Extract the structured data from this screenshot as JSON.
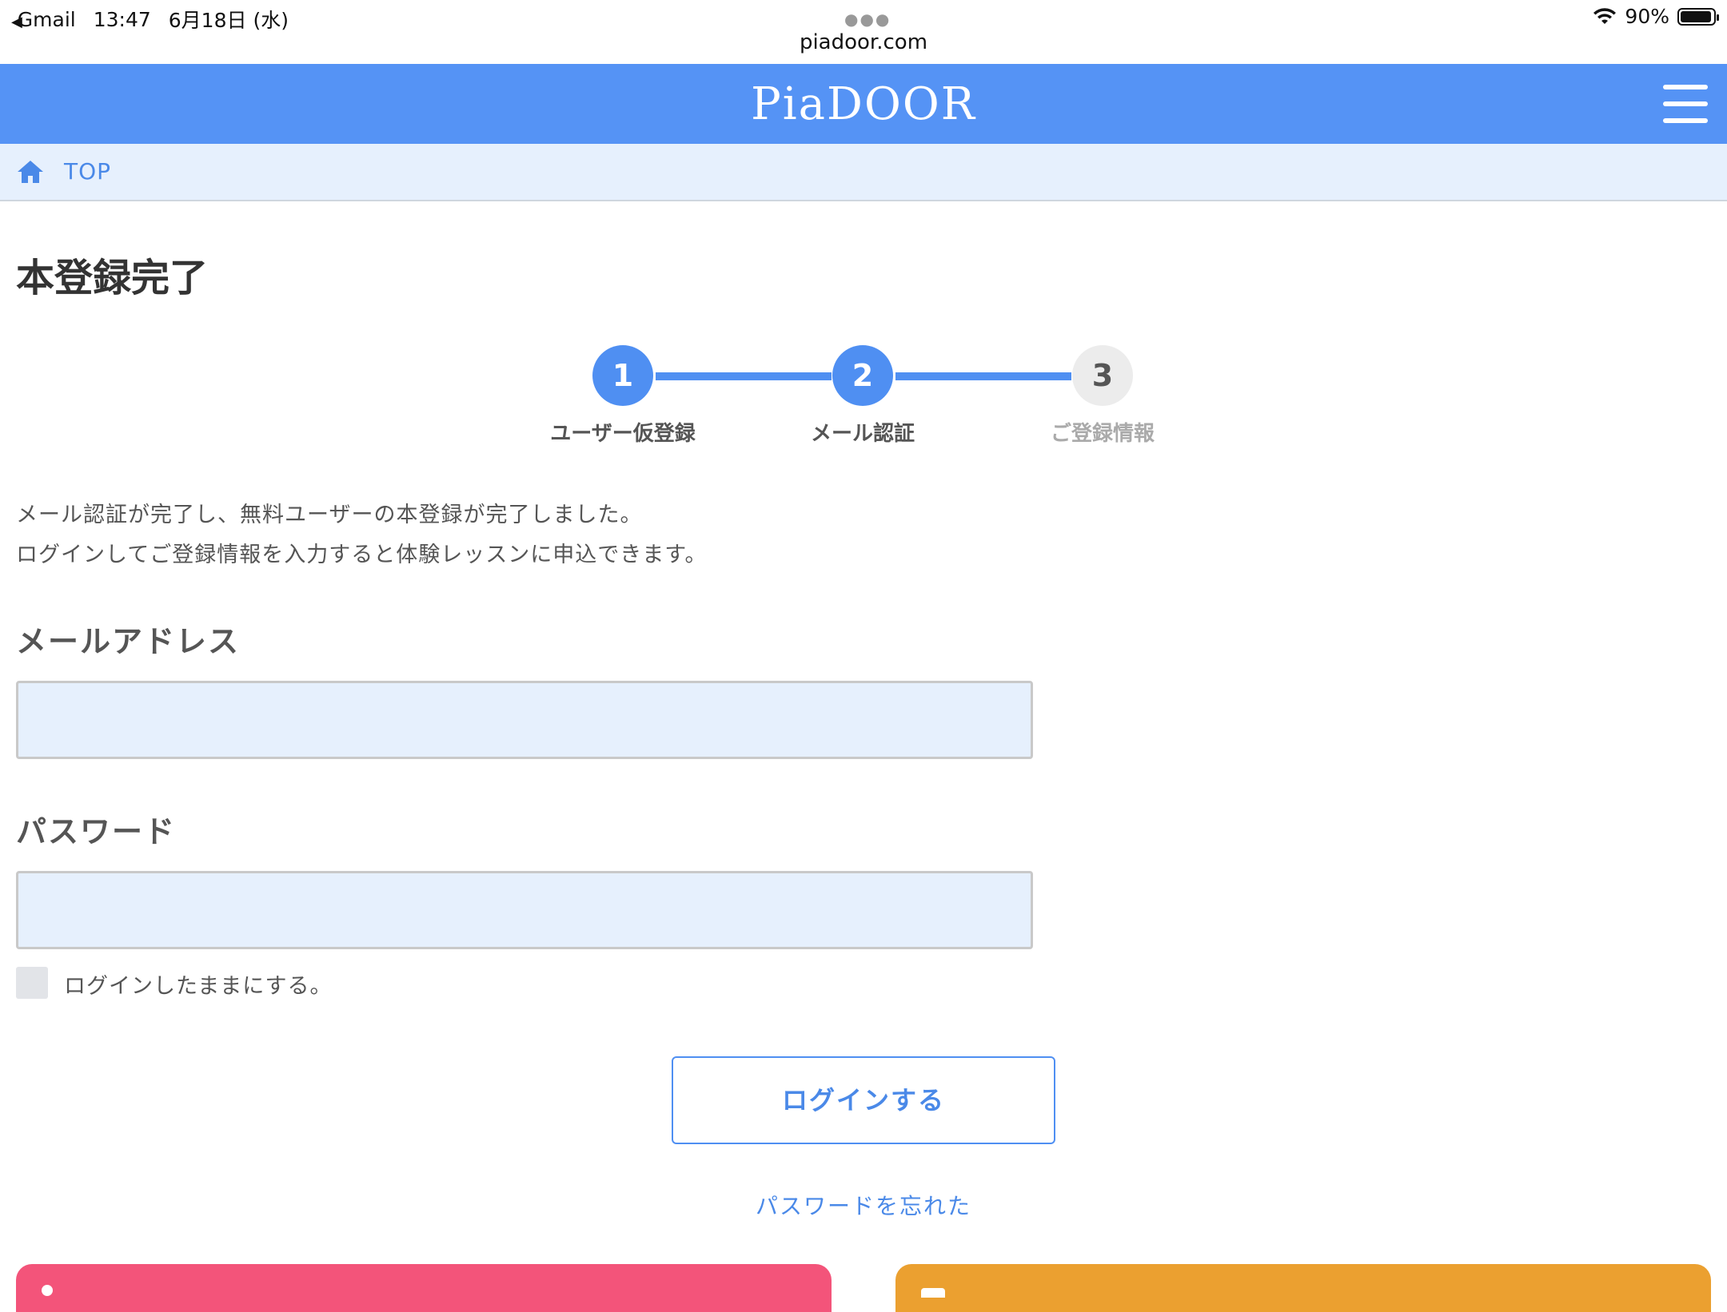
{
  "status_bar": {
    "back_app": "Gmail",
    "time": "13:47",
    "date": "6月18日 (水)",
    "url": "piadoor.com",
    "battery": "90%"
  },
  "header": {
    "logo": "PiaDOOR",
    "menu_icon": "hamburger-icon",
    "color": "#5593f5"
  },
  "breadcrumb": {
    "home_icon": "home-icon",
    "top_label": "TOP"
  },
  "page": {
    "title": "本登録完了"
  },
  "stepper": {
    "steps": [
      {
        "number": "1",
        "label": "ユーザー仮登録",
        "state": "completed"
      },
      {
        "number": "2",
        "label": "メール認証",
        "state": "current"
      },
      {
        "number": "3",
        "label": "ご登録情報",
        "state": "pending"
      }
    ],
    "active_color": "#4f8ff2"
  },
  "description": {
    "line1": "メール認証が完了し、無料ユーザーの本登録が完了しました。",
    "line2": "ログインしてご登録情報を入力すると体験レッスンに申込できます。"
  },
  "form": {
    "email_label": "メールアドレス",
    "email_value": "",
    "password_label": "パスワード",
    "password_value": "",
    "remember_label": "ログインしたままにする。",
    "remember_checked": false,
    "login_button": "ログインする",
    "forgot_link": "パスワードを忘れた"
  },
  "colors": {
    "link": "#4a89e8",
    "input_bg": "#e6f0fd",
    "card_pink": "#f3547a",
    "card_orange": "#eba030"
  }
}
